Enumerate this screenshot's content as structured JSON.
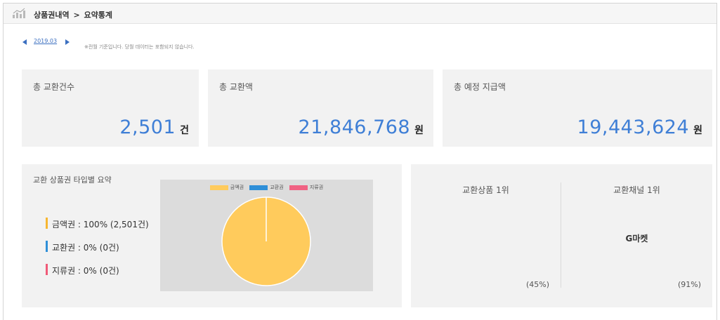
{
  "breadcrumb": {
    "parent": "상품권내역",
    "separator": ">",
    "current": "요약통계"
  },
  "period": {
    "label": "2019.03",
    "note": "※전월 기준입니다. 당월 데이터는 포함되지 않습니다."
  },
  "summary": [
    {
      "label": "총 교환건수",
      "value": "2,501",
      "unit": "건"
    },
    {
      "label": "총 교환액",
      "value": "21,846,768",
      "unit": "원"
    },
    {
      "label": "총 예정 지급액",
      "value": "19,443,624",
      "unit": "원"
    }
  ],
  "type_summary": {
    "title": "교환 상품권 타입별 요약",
    "items": [
      {
        "text": "금액권 : 100% (2,501건)",
        "color": "#f7b731"
      },
      {
        "text": "교환권 : 0% (0건)",
        "color": "#2f8fd8"
      },
      {
        "text": "지류권 : 0% (0건)",
        "color": "#f05a78"
      }
    ]
  },
  "chart_data": {
    "type": "pie",
    "categories": [
      "금액권",
      "교환권",
      "지류권"
    ],
    "values": [
      2501,
      0,
      0
    ],
    "colors": [
      "#ffcb5c",
      "#2f8fd8",
      "#f06283"
    ],
    "legend_position": "top"
  },
  "ranking": {
    "product": {
      "title": "교환상품 1위",
      "name": "",
      "percent": "(45%)"
    },
    "channel": {
      "title": "교환채널 1위",
      "name": "G마켓",
      "percent": "(91%)"
    }
  }
}
